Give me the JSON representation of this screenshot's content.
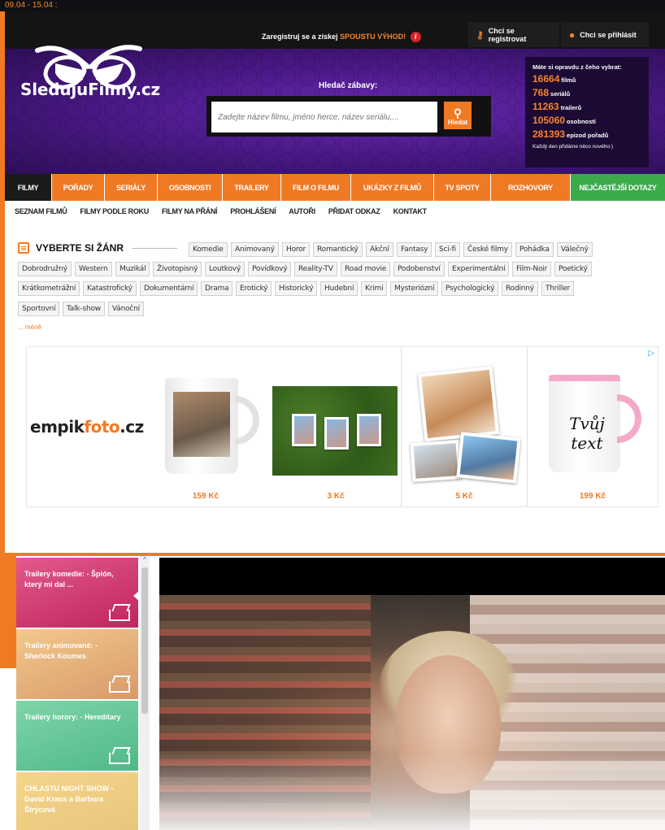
{
  "topbar": {
    "date_range": "09.04 - 15.04  :"
  },
  "header": {
    "register_cta": "Zaregistruj se a získej",
    "register_highlight": "SPOUSTU VÝHOD!",
    "register_link": "Chci se registrovat",
    "login_link": "Chci se přihlásit"
  },
  "logo": {
    "text": "SledujuFilmy.cz"
  },
  "search": {
    "title": "Hledač zábavy:",
    "placeholder": "Zadejte název filmu, jméno herce, název seriálu,...",
    "button_label": "Hledat"
  },
  "stats": {
    "heading": "Máte si opravdu z čeho vybrat:",
    "rows": [
      {
        "num": "16664",
        "label": "filmů"
      },
      {
        "num": "768",
        "label": "seriálů"
      },
      {
        "num": "11263",
        "label": "trailerů"
      },
      {
        "num": "105060",
        "label": "osobností"
      },
      {
        "num": "281393",
        "label": "epizod pořadů"
      }
    ],
    "footer": "Každý den přidáme něco nového:)"
  },
  "main_nav": [
    "Filmy",
    "Pořady",
    "Seriály",
    "Osobnosti",
    "Trailery",
    "Film o filmu",
    "Ukázky z filmů",
    "TV spoty",
    "Rozhovory",
    "Nejčastější dotazy"
  ],
  "sub_nav": [
    "Seznam filmů",
    "Filmy podle roku",
    "Filmy na přání",
    "Prohlášení",
    "Autoři",
    "Přidat odkaz",
    "Kontakt"
  ],
  "genres": {
    "title": "VYBERTE SI ŽÁNR",
    "less": "... méně",
    "chips": [
      "Komedie",
      "Animovaný",
      "Horor",
      "Romantický",
      "Akční",
      "Fantasy",
      "Sci-fi",
      "České filmy",
      "Pohádka",
      "Válečný",
      "Dobrodružný",
      "Western",
      "Muzikál",
      "Životopisný",
      "Loutkový",
      "Povídkový",
      "Reality-TV",
      "Road movie",
      "Podobenství",
      "Experimentální",
      "Film-Noir",
      "Poetický",
      "Krátkometrážní",
      "Katastrofický",
      "Dokumentární",
      "Drama",
      "Erotický",
      "Historický",
      "Hudební",
      "Krimi",
      "Mysteriózní",
      "Psychologický",
      "Rodinný",
      "Thriller",
      "Sportovní",
      "Talk-show",
      "Vánoční"
    ]
  },
  "ad": {
    "brand_prefix": "empik",
    "brand_highlight": "foto",
    "brand_suffix": ".cz",
    "mug_text_line1": "Tvůj",
    "mug_text_line2": "text",
    "prices": [
      "159 Kč",
      "3 Kč",
      "5 Kč",
      "199 Kč"
    ]
  },
  "gallery": {
    "cards": [
      "Trailery komedie: - Špión, který mi dal ...",
      "Trailery animované: - Sherlock Koumes",
      "Trailery horory: - Hereditary",
      "CHLASTU NIGHT SHOW - David Kraus a Barbora Štrýcová"
    ]
  },
  "colors": {
    "accent": "#f07a24",
    "purple": "#4c1a8a",
    "green": "#3bab4c"
  }
}
